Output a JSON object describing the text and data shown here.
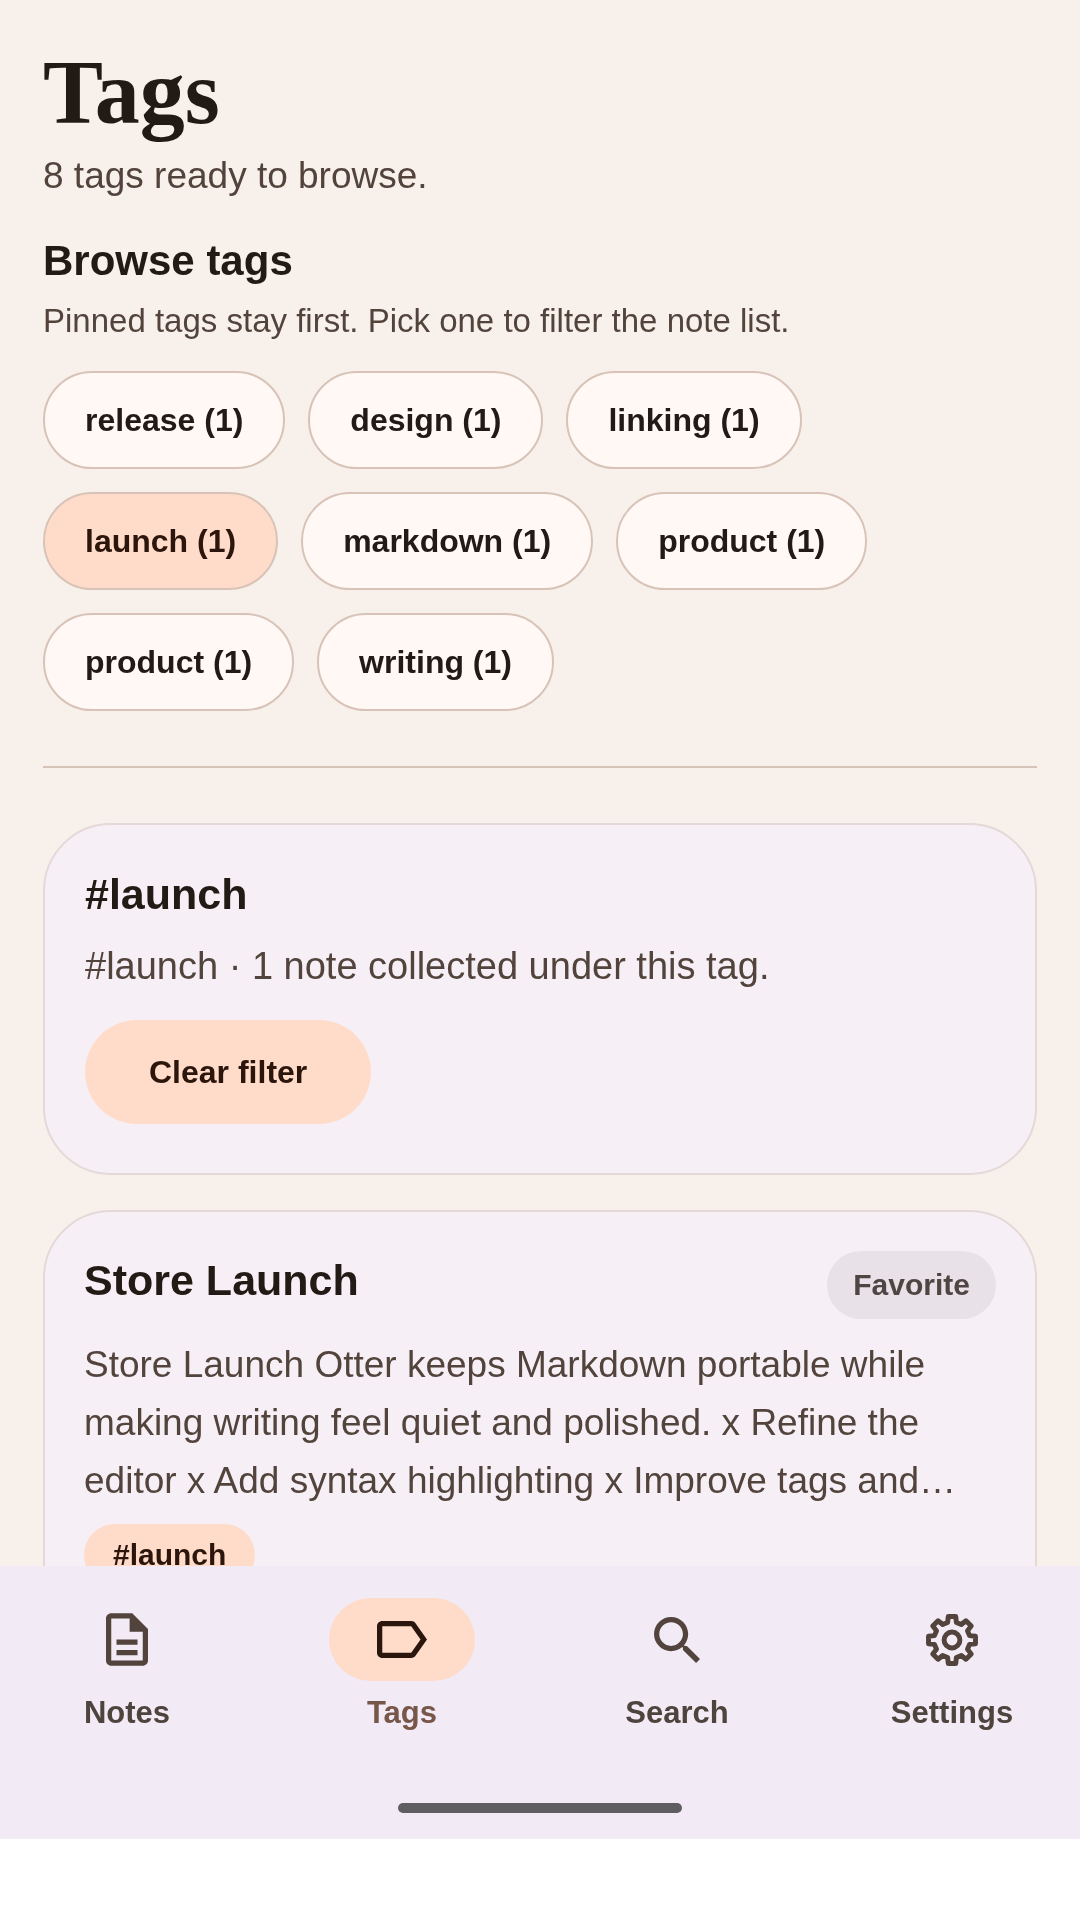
{
  "header": {
    "title": "Tags",
    "subtitle": "8 tags ready to browse."
  },
  "browse": {
    "heading": "Browse tags",
    "hint": "Pinned tags stay first. Pick one to filter the note list.",
    "chips": [
      {
        "label": "release (1)",
        "selected": false
      },
      {
        "label": "design (1)",
        "selected": false
      },
      {
        "label": "linking (1)",
        "selected": false
      },
      {
        "label": "launch (1)",
        "selected": true
      },
      {
        "label": "markdown (1)",
        "selected": false
      },
      {
        "label": "product (1)",
        "selected": false
      },
      {
        "label": "product (1)",
        "selected": false
      },
      {
        "label": "writing (1)",
        "selected": false
      }
    ]
  },
  "filter": {
    "title": "#launch",
    "summary": "#launch · 1 note collected under this tag.",
    "button": "Clear filter"
  },
  "notes": [
    {
      "title": "Store Launch",
      "badge": "Favorite",
      "excerpt": "Store Launch Otter keeps Markdown portable while making writing feel quiet and polished. x Refine the editor x Add syntax highlighting x Improve tags and…",
      "tags": [
        "#launch"
      ]
    }
  ],
  "nav": {
    "items": [
      {
        "kind": "notes",
        "label": "Notes",
        "selected": false
      },
      {
        "kind": "tags",
        "label": "Tags",
        "selected": true
      },
      {
        "kind": "search",
        "label": "Search",
        "selected": false
      },
      {
        "kind": "settings",
        "label": "Settings",
        "selected": false
      }
    ]
  }
}
